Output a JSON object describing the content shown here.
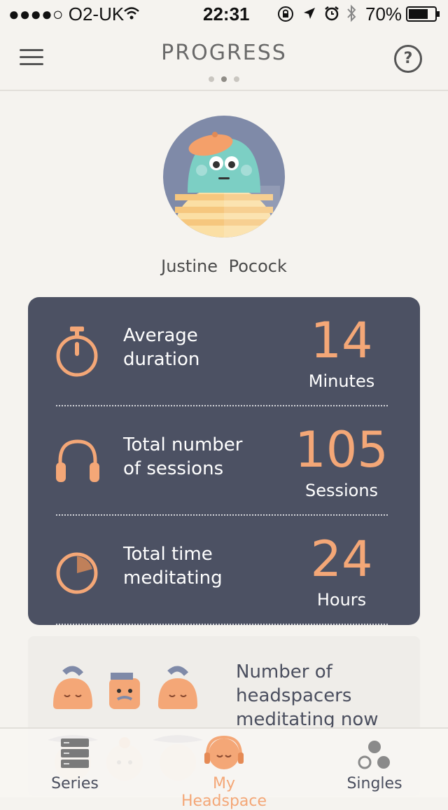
{
  "status_bar": {
    "carrier": "●●●●○ O2-UK",
    "time": "22:31",
    "battery": "70%"
  },
  "header": {
    "title": "PROGRESS",
    "help_glyph": "?"
  },
  "profile": {
    "name": "Justine  Pocock"
  },
  "stats": [
    {
      "icon": "stopwatch-icon",
      "label": "Average duration",
      "value": "14",
      "unit": "Minutes"
    },
    {
      "icon": "headphones-icon",
      "label": "Total number of sessions",
      "value": "105",
      "unit": "Sessions"
    },
    {
      "icon": "pie-clock-icon",
      "label": "Total time meditating",
      "value": "24",
      "unit": "Hours"
    }
  ],
  "community": {
    "text": "Number of headspacers meditating now"
  },
  "tab_bar": {
    "tabs": [
      {
        "label": "Series",
        "icon": "stack-icon"
      },
      {
        "label": "My Headspace",
        "icon": "headspace-face-icon"
      },
      {
        "label": "Singles",
        "icon": "circles-icon"
      }
    ],
    "active": "My Headspace"
  },
  "colors": {
    "accent": "#f4a777",
    "card": "#4c5163",
    "background": "#f5f3ef"
  }
}
